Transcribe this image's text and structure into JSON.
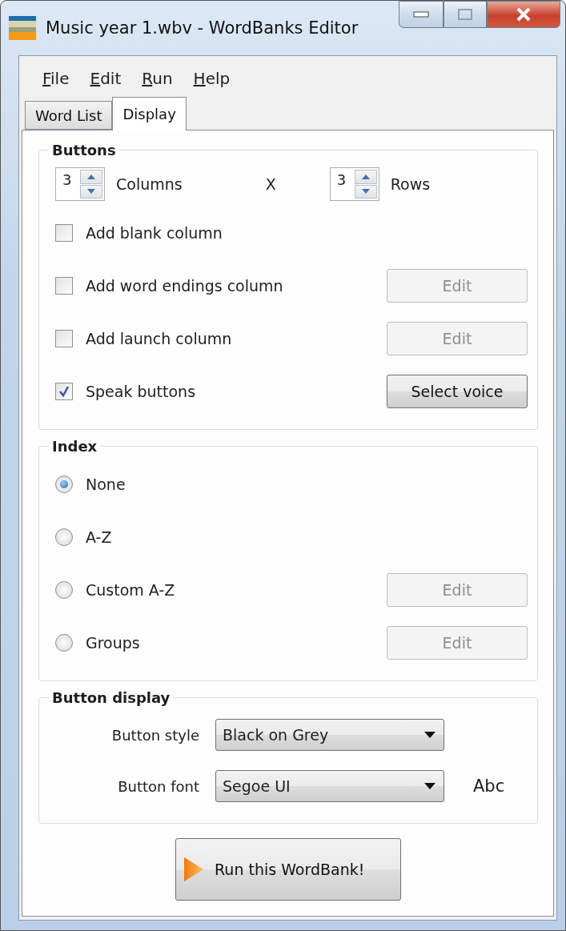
{
  "window": {
    "title": "Music year 1.wbv - WordBanks Editor"
  },
  "menu": [
    "File",
    "Edit",
    "Run",
    "Help"
  ],
  "tabs": [
    {
      "label": "Word List",
      "selected": false
    },
    {
      "label": "Display",
      "selected": true
    }
  ],
  "buttons_group": {
    "title": "Buttons",
    "columns": {
      "value": "3",
      "label": "Columns"
    },
    "separator": "X",
    "rows": {
      "value": "3",
      "label": "Rows"
    },
    "options": [
      {
        "label": "Add blank column",
        "checked": false
      },
      {
        "label": "Add word endings column",
        "checked": false,
        "button": {
          "label": "Edit",
          "disabled": true
        }
      },
      {
        "label": "Add launch column",
        "checked": false,
        "button": {
          "label": "Edit",
          "disabled": true
        }
      },
      {
        "label": "Speak buttons",
        "checked": true,
        "button": {
          "label": "Select voice",
          "disabled": false
        }
      }
    ]
  },
  "index_group": {
    "title": "Index",
    "options": [
      {
        "label": "None",
        "selected": true
      },
      {
        "label": "A-Z",
        "selected": false
      },
      {
        "label": "Custom A-Z",
        "selected": false,
        "button": {
          "label": "Edit",
          "disabled": true
        }
      },
      {
        "label": "Groups",
        "selected": false,
        "button": {
          "label": "Edit",
          "disabled": true
        }
      }
    ]
  },
  "display_group": {
    "title": "Button display",
    "fields": [
      {
        "label": "Button style",
        "value": "Black on Grey"
      },
      {
        "label": "Button font",
        "value": "Segoe UI",
        "preview": "Abc"
      }
    ]
  },
  "run_button": {
    "label": "Run this WordBank!"
  }
}
